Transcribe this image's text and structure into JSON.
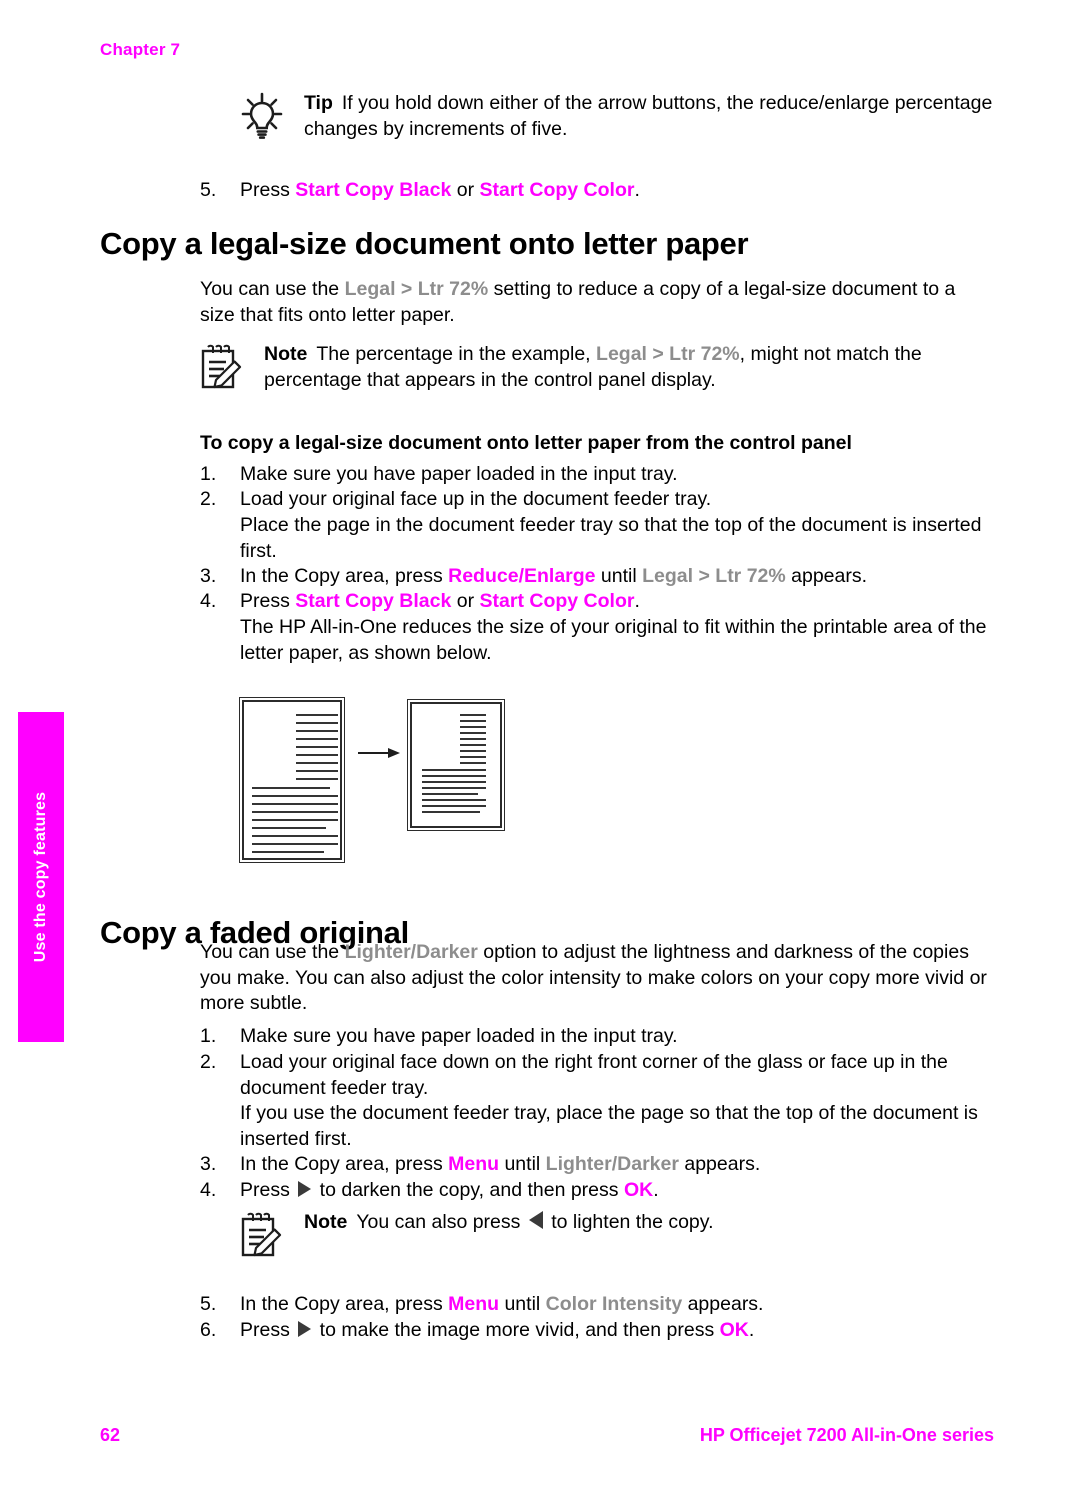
{
  "document": {
    "chapter_label": "Chapter 7",
    "side_tab_label": "Use the copy features",
    "footer": {
      "page_number": "62",
      "product": "HP Officejet 7200 All-in-One series"
    },
    "colors": {
      "accent": "#ff00ff",
      "ui_term": "#8d8d8d",
      "body_text": "#000000"
    }
  },
  "tip_box": {
    "icon": "lightbulb-icon",
    "label": "Tip",
    "text": "If you hold down either of the arrow buttons, the reduce/enlarge percentage changes by increments of five."
  },
  "step_prev": {
    "number": "5.",
    "pre": "Press ",
    "btn_black": "Start Copy Black",
    "mid": " or ",
    "btn_color": "Start Copy Color",
    "post": "."
  },
  "section_legal": {
    "title": "Copy a legal-size document onto letter paper",
    "intro": {
      "pre": "You can use the ",
      "term": "Legal > Ltr 72%",
      "post": " setting to reduce a copy of a legal-size document to a size that fits onto letter paper."
    },
    "note": {
      "icon": "note-pencil-icon",
      "label": "Note",
      "pre": "The percentage in the example, ",
      "term": "Legal > Ltr 72%",
      "post": ", might not match the percentage that appears in the control panel display."
    },
    "list_heading": "To copy a legal-size document onto letter paper from the control panel",
    "steps": [
      {
        "number": "1.",
        "text": "Make sure you have paper loaded in the input tray."
      },
      {
        "number": "2.",
        "text": "Load your original face up in the document feeder tray."
      },
      {
        "number": "",
        "text": "Place the page in the document feeder tray so that the top of the document is inserted first."
      },
      {
        "number": "3.",
        "pre": "In the Copy area, press ",
        "accent": "Reduce/Enlarge",
        "mid": " until ",
        "term": "Legal > Ltr 72%",
        "post": " appears."
      },
      {
        "number": "4.",
        "pre": "Press ",
        "accent": "Start Copy Black",
        "mid": " or ",
        "accent2": "Start Copy Color",
        "post": "."
      },
      {
        "number": "",
        "text": "The HP All-in-One reduces the size of your original to fit within the printable area of the letter paper, as shown below."
      }
    ],
    "figure": {
      "name": "legal-to-letter-reduction-figure",
      "left_sheet": "legal-size page",
      "right_sheet": "letter-size page",
      "arrow": "right-arrow"
    }
  },
  "section_faded": {
    "title": "Copy a faded original",
    "intro": {
      "pre": "You can use the ",
      "term": "Lighter/Darker",
      "post": " option to adjust the lightness and darkness of the copies you make. You can also adjust the color intensity to make colors on your copy more vivid or more subtle."
    },
    "steps": [
      {
        "number": "1.",
        "text": "Make sure you have paper loaded in the input tray."
      },
      {
        "number": "2.",
        "text": "Load your original face down on the right front corner of the glass or face up in the document feeder tray."
      },
      {
        "number": "",
        "text": "If you use the document feeder tray, place the page so that the top of the document is inserted first."
      },
      {
        "number": "3.",
        "pre": "In the Copy area, press ",
        "accent": "Menu",
        "mid": " until ",
        "term": "Lighter/Darker",
        "post": " appears."
      },
      {
        "number": "4.",
        "pre": "Press ",
        "glyph": "right-triangle",
        "mid": " to darken the copy, and then press ",
        "accent": "OK",
        "post": "."
      },
      {
        "number": "5.",
        "pre": "In the Copy area, press ",
        "accent": "Menu",
        "mid": " until ",
        "term": "Color Intensity",
        "post": " appears."
      },
      {
        "number": "6.",
        "pre": "Press ",
        "glyph": "right-triangle",
        "mid": " to make the image more vivid, and then press ",
        "accent": "OK",
        "post": "."
      }
    ],
    "note": {
      "icon": "note-pencil-icon",
      "label": "Note",
      "pre": "You can also press ",
      "glyph": "left-triangle",
      "post": " to lighten the copy."
    }
  }
}
